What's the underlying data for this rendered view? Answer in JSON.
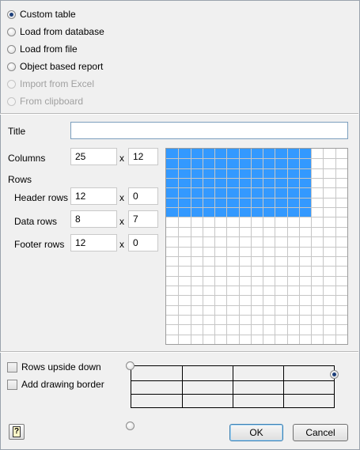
{
  "source_options": [
    {
      "label": "Custom table",
      "checked": true,
      "enabled": true
    },
    {
      "label": "Load from database",
      "checked": false,
      "enabled": true
    },
    {
      "label": "Load from file",
      "checked": false,
      "enabled": true
    },
    {
      "label": "Object based report",
      "checked": false,
      "enabled": true
    },
    {
      "label": "Import from Excel",
      "checked": false,
      "enabled": false
    },
    {
      "label": "From clipboard",
      "checked": false,
      "enabled": false
    }
  ],
  "form": {
    "title_label": "Title",
    "title_value": "",
    "columns_label": "Columns",
    "columns_value": "25",
    "columns_width": "12",
    "rows_label": "Rows",
    "header_rows_label": "Header rows",
    "header_rows_value": "12",
    "header_rows_height": "0",
    "data_rows_label": "Data rows",
    "data_rows_value": "8",
    "data_rows_height": "7",
    "footer_rows_label": "Footer rows",
    "footer_rows_value": "12",
    "footer_rows_height": "0",
    "x_sign": "x"
  },
  "grid_selector": {
    "total_columns": 15,
    "total_rows": 20,
    "selected_columns": 12,
    "selected_rows": 7,
    "selected_color": "#3399ff",
    "line_color": "#c6c6c6"
  },
  "options": {
    "rows_upside_down_label": "Rows upside down",
    "rows_upside_down_checked": false,
    "add_drawing_border_label": "Add drawing border",
    "add_drawing_border_checked": false
  },
  "anchor": {
    "selected": "top-right"
  },
  "buttons": {
    "ok_label": "OK",
    "cancel_label": "Cancel",
    "help_icon": "help-icon"
  }
}
